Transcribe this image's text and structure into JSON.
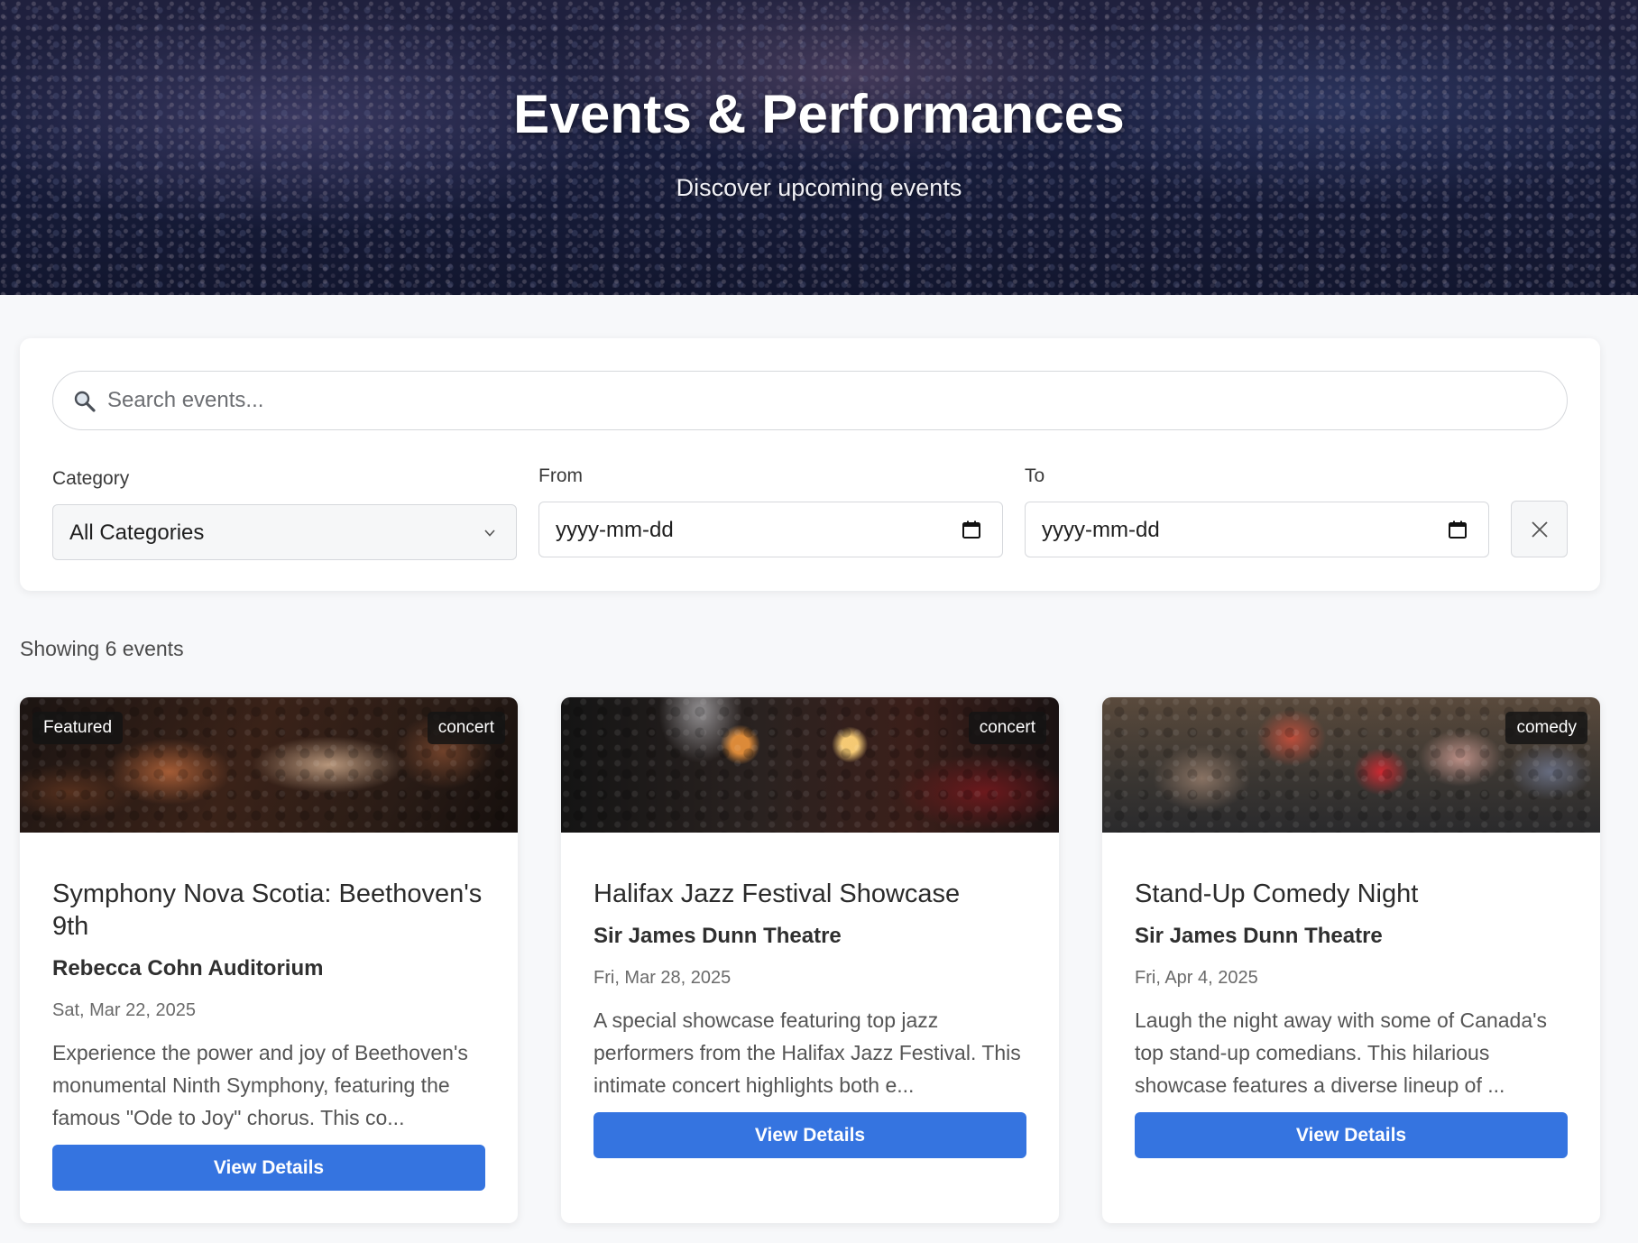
{
  "hero": {
    "title": "Events & Performances",
    "subtitle": "Discover upcoming events"
  },
  "filters": {
    "search_placeholder": "Search events...",
    "category_label": "Category",
    "category_value": "All Categories",
    "from_label": "From",
    "from_value": "yyyy-mm-dd",
    "to_label": "To",
    "to_value": "yyyy-mm-dd",
    "clear_icon": "close-icon"
  },
  "results": {
    "count_text": "Showing 6 events"
  },
  "events": [
    {
      "featured_label": "Featured",
      "category": "concert",
      "image": "orchestra-photo",
      "title": "Symphony Nova Scotia: Beethoven's 9th",
      "venue": "Rebecca Cohn Auditorium",
      "date": "Sat, Mar 22, 2025",
      "description": "Experience the power and joy of Beethoven's monumental Ninth Symphony, featuring the famous \"Ode to Joy\" chorus. This co...",
      "button": "View Details"
    },
    {
      "category": "concert",
      "image": "jazz-stage-photo",
      "title": "Halifax Jazz Festival Showcase",
      "venue": "Sir James Dunn Theatre",
      "date": "Fri, Mar 28, 2025",
      "description": "A special showcase featuring top jazz performers from the Halifax Jazz Festival. This intimate concert highlights both e...",
      "button": "View Details"
    },
    {
      "category": "comedy",
      "image": "comedy-crowd-photo",
      "title": "Stand-Up Comedy Night",
      "venue": "Sir James Dunn Theatre",
      "date": "Fri, Apr 4, 2025",
      "description": "Laugh the night away with some of Canada's top stand-up comedians. This hilarious showcase features a diverse lineup of ...",
      "button": "View Details"
    }
  ],
  "colors": {
    "accent": "#3574e0",
    "page_bg": "#f7f8fa",
    "tag_bg": "#141414"
  }
}
